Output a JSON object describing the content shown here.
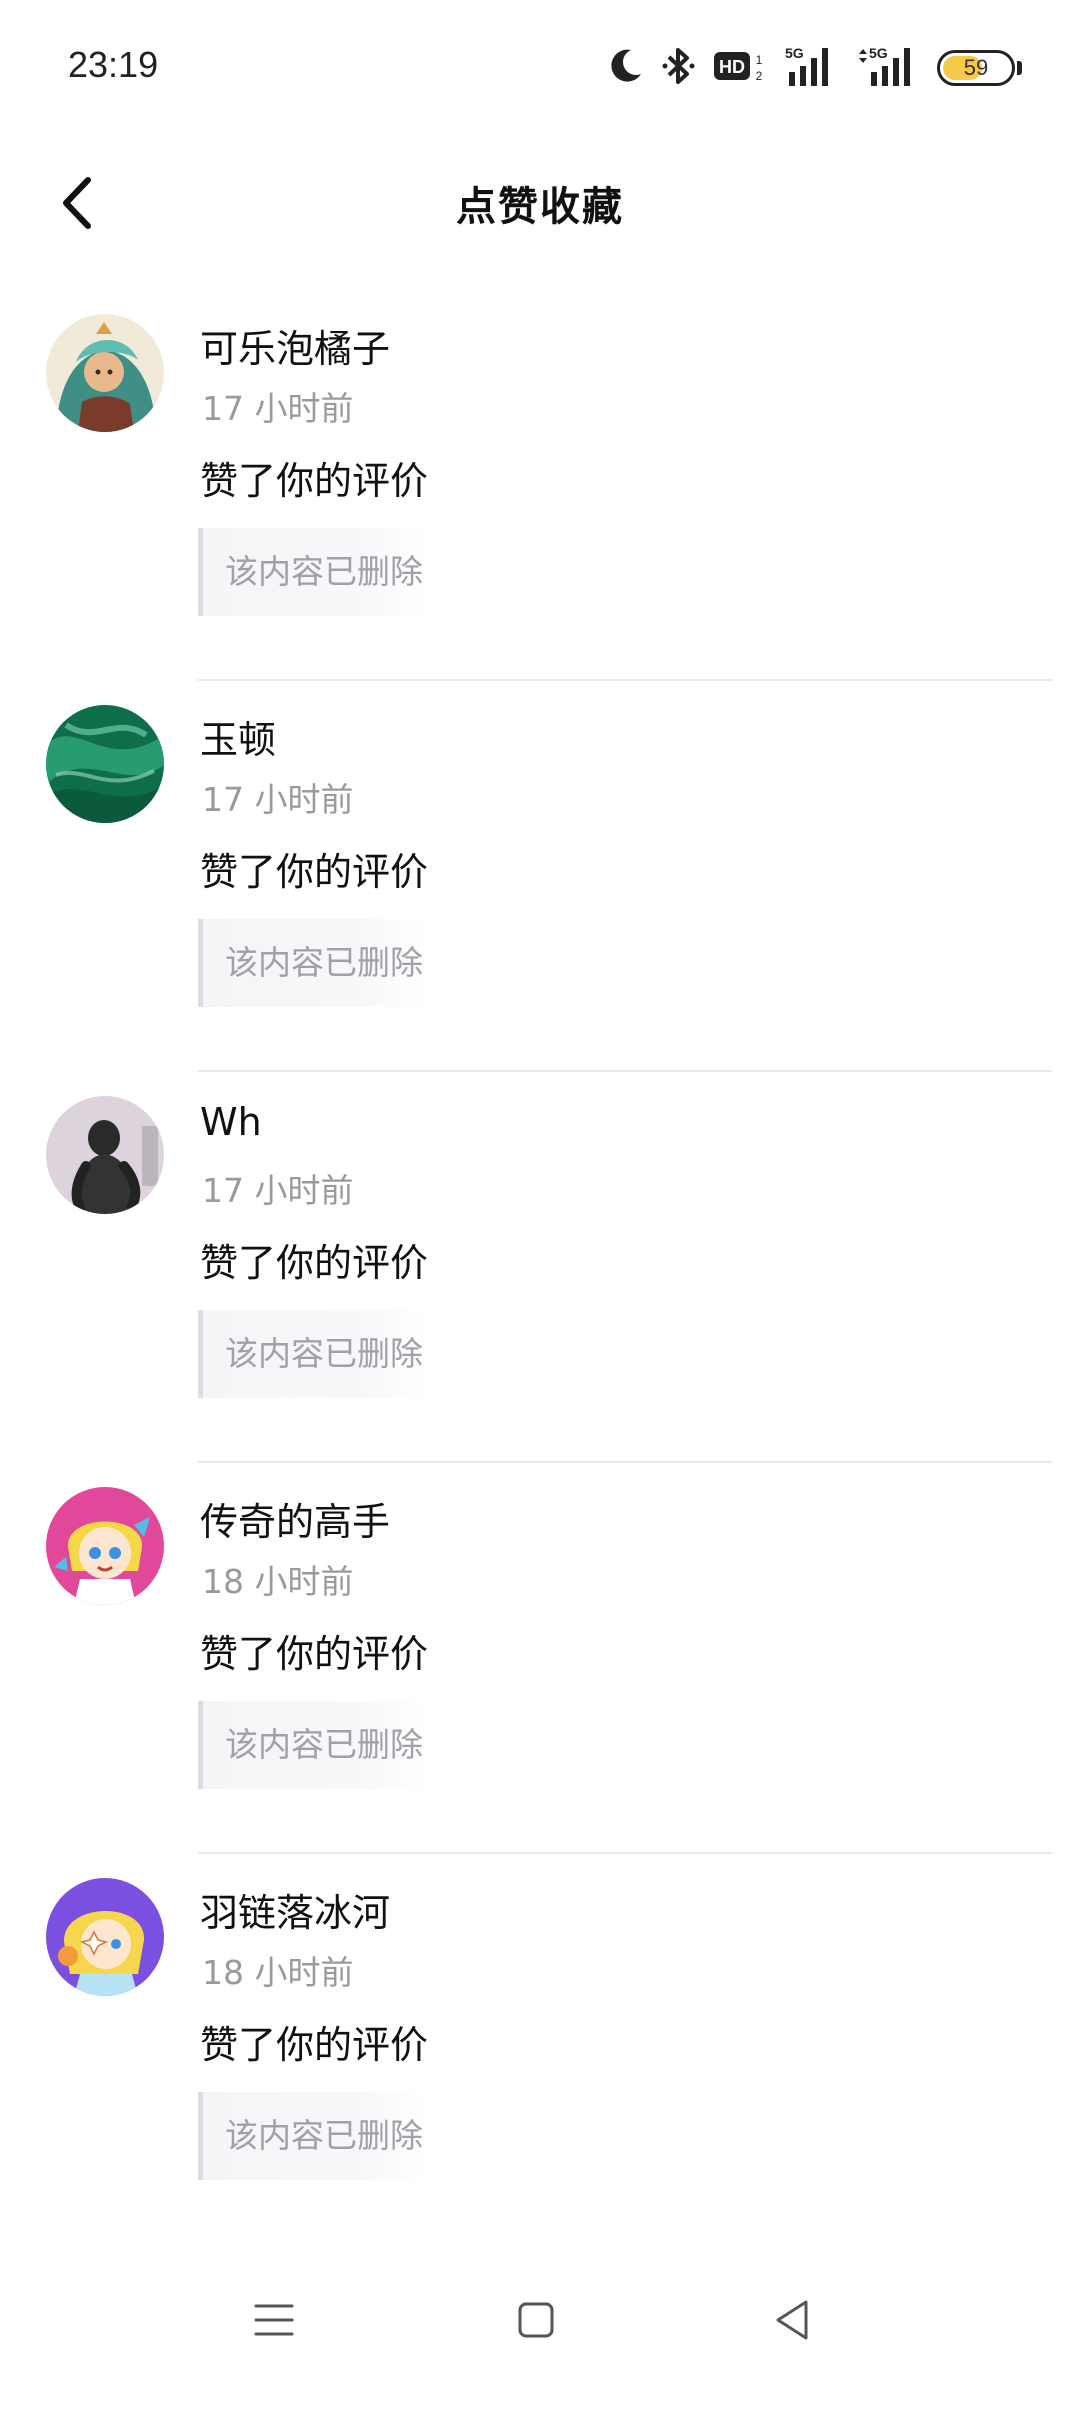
{
  "status_bar": {
    "time": "23:19",
    "battery_level": "59",
    "icons": [
      "moon-icon",
      "bluetooth-icon",
      "hd-icon",
      "signal-5g-icon",
      "signal-5g-icon-2"
    ]
  },
  "header": {
    "title": "点赞收藏",
    "back_icon": "chevron-left-icon"
  },
  "notifications": [
    {
      "username": "可乐泡橘子",
      "time": "17 小时前",
      "action": "赞了你的评价",
      "quoted": "该内容已删除"
    },
    {
      "username": "玉顿",
      "time": "17 小时前",
      "action": "赞了你的评价",
      "quoted": "该内容已删除"
    },
    {
      "username": "Wh",
      "time": "17 小时前",
      "action": "赞了你的评价",
      "quoted": "该内容已删除"
    },
    {
      "username": "传奇的高手",
      "time": "18 小时前",
      "action": "赞了你的评价",
      "quoted": "该内容已删除"
    },
    {
      "username": "羽链落冰河",
      "time": "18 小时前",
      "action": "赞了你的评价",
      "quoted": "该内容已删除"
    }
  ],
  "nav_bar": {
    "icons": [
      "menu-icon",
      "home-square-icon",
      "back-triangle-icon"
    ]
  },
  "colors": {
    "accent_battery": "#f7c948",
    "muted_text": "#9a9a9a",
    "divider": "#e8e8ea"
  }
}
